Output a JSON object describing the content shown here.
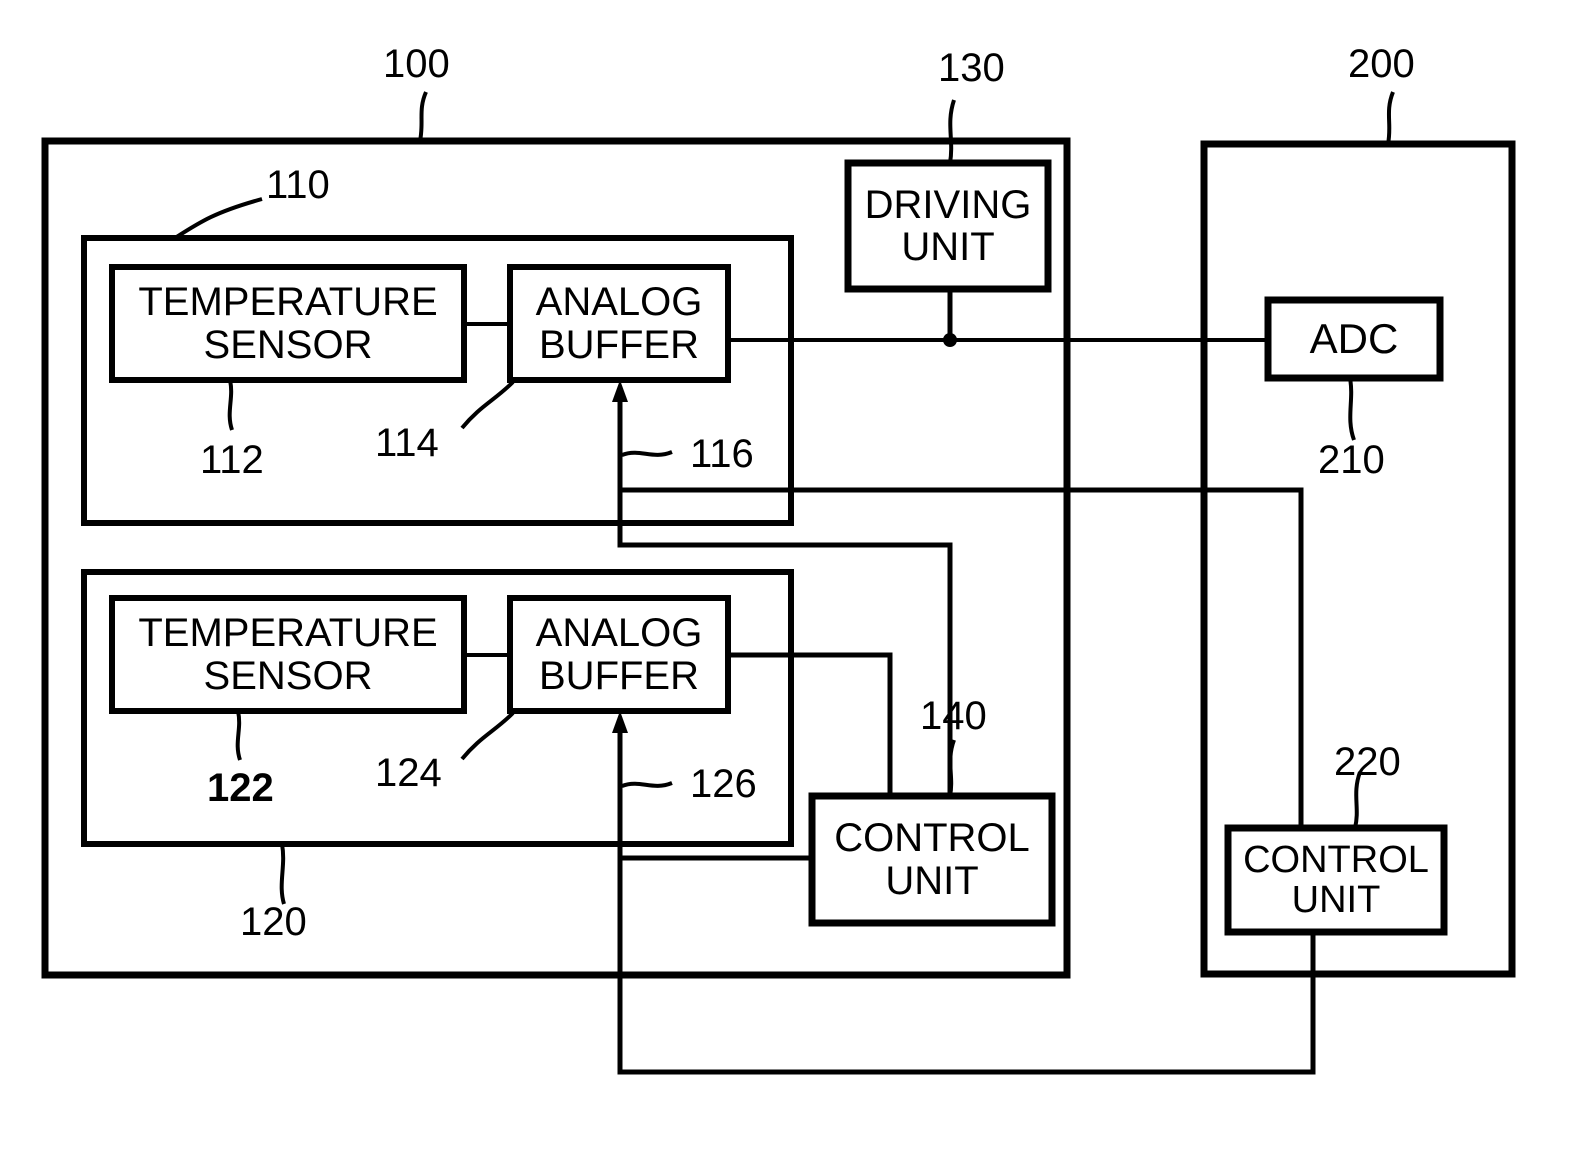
{
  "figure": {
    "type": "patent-block-diagram",
    "description": "Temperature sensing apparatus block diagram with two temperature sensing blocks, driving unit, control units, and an ADC"
  },
  "blocks": [
    {
      "id": "temperature-sensor-1",
      "ref": "112",
      "line1": "TEMPERATURE",
      "line2": "SENSOR"
    },
    {
      "id": "analog-buffer-1",
      "ref": "114",
      "line1": "ANALOG",
      "line2": "BUFFER"
    },
    {
      "id": "temperature-sensor-2",
      "ref": "122",
      "line1": "TEMPERATURE",
      "line2": "SENSOR"
    },
    {
      "id": "analog-buffer-2",
      "ref": "124",
      "line1": "ANALOG",
      "line2": "BUFFER"
    },
    {
      "id": "driving-unit",
      "ref": "130",
      "line1": "DRIVING",
      "line2": "UNIT"
    },
    {
      "id": "control-unit-device",
      "ref": "140",
      "line1": "CONTROL",
      "line2": "UNIT"
    },
    {
      "id": "adc",
      "ref": "210",
      "line1": "ADC",
      "line2": ""
    },
    {
      "id": "control-unit-host",
      "ref": "220",
      "line1": "CONTROL",
      "line2": "UNIT"
    }
  ],
  "reference_numerals": {
    "outer_device": "100",
    "sensing_block_1": "110",
    "temp_sensor_1": "112",
    "analog_buffer_1": "114",
    "buffer_enable_1": "116",
    "sensing_block_2": "120",
    "temp_sensor_2": "122",
    "analog_buffer_2": "124",
    "buffer_enable_2": "126",
    "driving_unit": "130",
    "control_unit_device": "140",
    "outer_host": "200",
    "adc": "210",
    "control_unit_host": "220"
  },
  "labels": {
    "temperature_sensor_l1": "TEMPERATURE",
    "temperature_sensor_l2": "SENSOR",
    "analog_buffer_l1": "ANALOG",
    "analog_buffer_l2": "BUFFER",
    "driving_unit_l1": "DRIVING",
    "driving_unit_l2": "UNIT",
    "control_unit_l1": "CONTROL",
    "control_unit_l2": "UNIT",
    "adc": "ADC"
  },
  "style": {
    "stroke": "#000000",
    "background": "#ffffff"
  }
}
